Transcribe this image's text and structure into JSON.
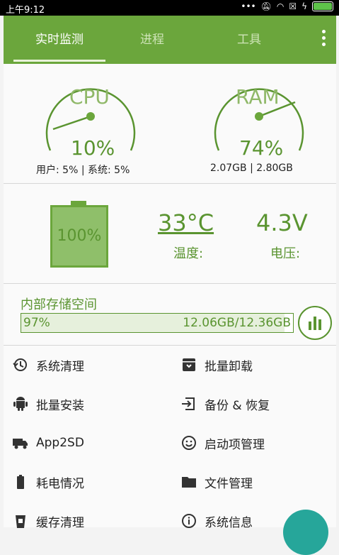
{
  "status_bar": {
    "time": "上午9:12"
  },
  "tabs": [
    {
      "label": "实时监测"
    },
    {
      "label": "进程"
    },
    {
      "label": "工具"
    }
  ],
  "cpu": {
    "title": "CPU",
    "percent": "10%",
    "detail": "用户: 5% | 系统: 5%"
  },
  "ram": {
    "title": "RAM",
    "percent": "74%",
    "detail": "2.07GB | 2.80GB"
  },
  "battery": {
    "percent": "100%",
    "level": 1.0
  },
  "temperature": {
    "value": "33°C",
    "label": "温度:"
  },
  "voltage": {
    "value": "4.3V",
    "label": "电压:"
  },
  "storage": {
    "title": "内部存储空间",
    "percent": "97%",
    "usage": "12.06GB/12.36GB",
    "level": 0.97
  },
  "menu": {
    "left": [
      {
        "label": "系统清理",
        "icon": "history-icon"
      },
      {
        "label": "批量安装",
        "icon": "android-icon"
      },
      {
        "label": "App2SD",
        "icon": "truck-icon"
      },
      {
        "label": "耗电情况",
        "icon": "battery-icon"
      },
      {
        "label": "缓存清理",
        "icon": "trash-icon"
      }
    ],
    "right": [
      {
        "label": "批量卸载",
        "icon": "archive-icon"
      },
      {
        "label": "备份 & 恢复",
        "icon": "restore-icon"
      },
      {
        "label": "启动项管理",
        "icon": "smiley-icon"
      },
      {
        "label": "文件管理",
        "icon": "folder-icon"
      },
      {
        "label": "系统信息",
        "icon": "info-icon"
      }
    ]
  },
  "colors": {
    "accent": "#6ba63c",
    "gauge": "#5a9430",
    "fab": "#26a69a"
  }
}
